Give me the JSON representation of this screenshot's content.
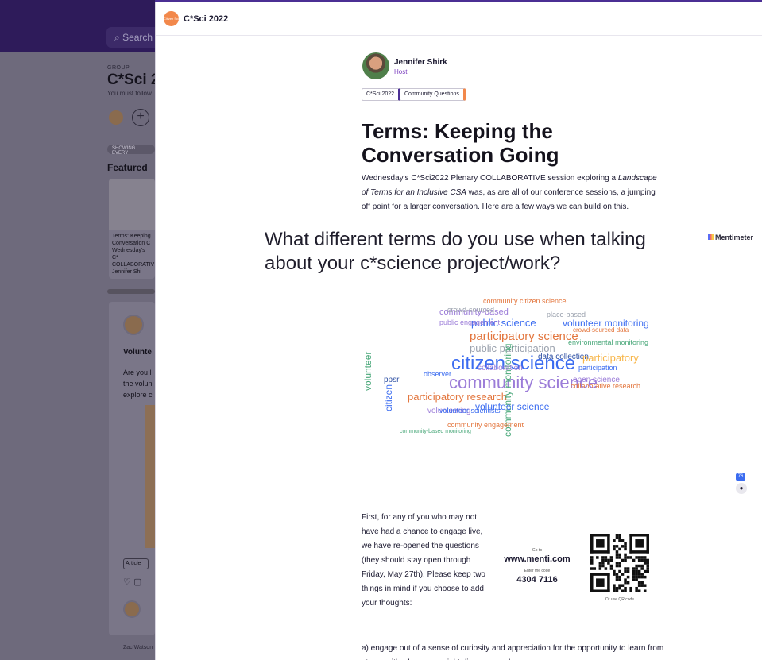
{
  "background": {
    "search_placeholder": "Search",
    "group_label": "GROUP",
    "group_title": "C*Sci 20",
    "follow_text": "You must follow",
    "showing_label": "SHOWING EVERY",
    "featured_heading": "Featured",
    "featured_card_text": "Terms: Keeping Conversation C Wednesday's C* COLLABORATIV Jennifer Shi",
    "post_title": "Volunte",
    "post_text_lines": [
      "Are you l",
      "the volun",
      "explore c"
    ],
    "tag_label": "Article",
    "next_author": "Zac Watson"
  },
  "modal": {
    "group_name": "C*Sci 2022",
    "group_logo_text": "Citizen Sci",
    "host": {
      "name": "Jennifer Shirk",
      "role": "Host"
    },
    "tags": [
      "C*Sci 2022",
      "Community Questions"
    ],
    "title": "Terms: Keeping the Conversation Going",
    "intro_parts": {
      "before": "Wednesday's C*Sci2022 Plenary COLLABORATIVE session exploring a ",
      "italic": "Landscape of Terms for an Inclusive CSA",
      "after": " was, as are all of our conference sessions, a jumping off point for a larger conversation. Here are a few ways we can build on this."
    },
    "menti": {
      "question": "What different terms do you use when talking about your c*science project/work?",
      "logo_text": "Mentimeter",
      "participant_count": "76"
    },
    "first_paragraph": "First, for any of you who may not have had a chance to engage live, we have re-opened the questions (they should stay open through Friday, May 27th). Please keep two things in mind if you choose to add your thoughts:",
    "goto": {
      "label": "Go to",
      "url": "www.menti.com",
      "code_label": "Enter the code",
      "code": "4304 7116",
      "qr_caption": "Or use QR code"
    },
    "point_a": "a) engage out of a sense of curiosity and appreciation for the opportunity to learn from others with whom you might disagree, and"
  },
  "colors": {
    "brand_purple": "#4b2f94",
    "host_role": "#7b3fbf",
    "group_orange": "#f2884b"
  },
  "wordcloud": [
    {
      "t": "citizen science",
      "c": "#3b6cf0"
    },
    {
      "t": "community science",
      "c": "#9b7cd8"
    },
    {
      "t": "participatory science",
      "c": "#e3763e"
    },
    {
      "t": "participatory research",
      "c": "#e3763e"
    },
    {
      "t": "public participation",
      "c": "#9aa1ad"
    },
    {
      "t": "public science",
      "c": "#3b6cf0"
    },
    {
      "t": "volunteer monitoring",
      "c": "#3b6cf0"
    },
    {
      "t": "community monitoring",
      "c": "#4aa87a"
    },
    {
      "t": "volunteer science",
      "c": "#3b6cf0"
    },
    {
      "t": "community-based",
      "c": "#9b7cd8"
    },
    {
      "t": "crowd-sourced",
      "c": "#9aa1ad"
    },
    {
      "t": "data collection",
      "c": "#2d4fa3"
    },
    {
      "t": "open science",
      "c": "#9b7cd8"
    },
    {
      "t": "volunteering",
      "c": "#9b7cd8"
    },
    {
      "t": "collaboration",
      "c": "#9b7cd8"
    },
    {
      "t": "community engagement",
      "c": "#e3763e"
    },
    {
      "t": "public engagement",
      "c": "#9b7cd8"
    },
    {
      "t": "community citizen science",
      "c": "#e3763e"
    },
    {
      "t": "environmental monitoring",
      "c": "#4aa87a"
    },
    {
      "t": "crowd-sourced data",
      "c": "#e3763e"
    },
    {
      "t": "place-based",
      "c": "#9aa1ad"
    },
    {
      "t": "participatory",
      "c": "#f7b64a"
    },
    {
      "t": "volunteer scientists",
      "c": "#3b6cf0"
    },
    {
      "t": "participation",
      "c": "#3b6cf0"
    },
    {
      "t": "collaborative research",
      "c": "#e3763e"
    },
    {
      "t": "volunteer",
      "c": "#4aa87a"
    },
    {
      "t": "citizen",
      "c": "#3b6cf0"
    },
    {
      "t": "ppsr",
      "c": "#2d4fa3"
    },
    {
      "t": "observer",
      "c": "#3b6cf0"
    },
    {
      "t": "community-based monitoring",
      "c": "#4aa87a"
    }
  ]
}
